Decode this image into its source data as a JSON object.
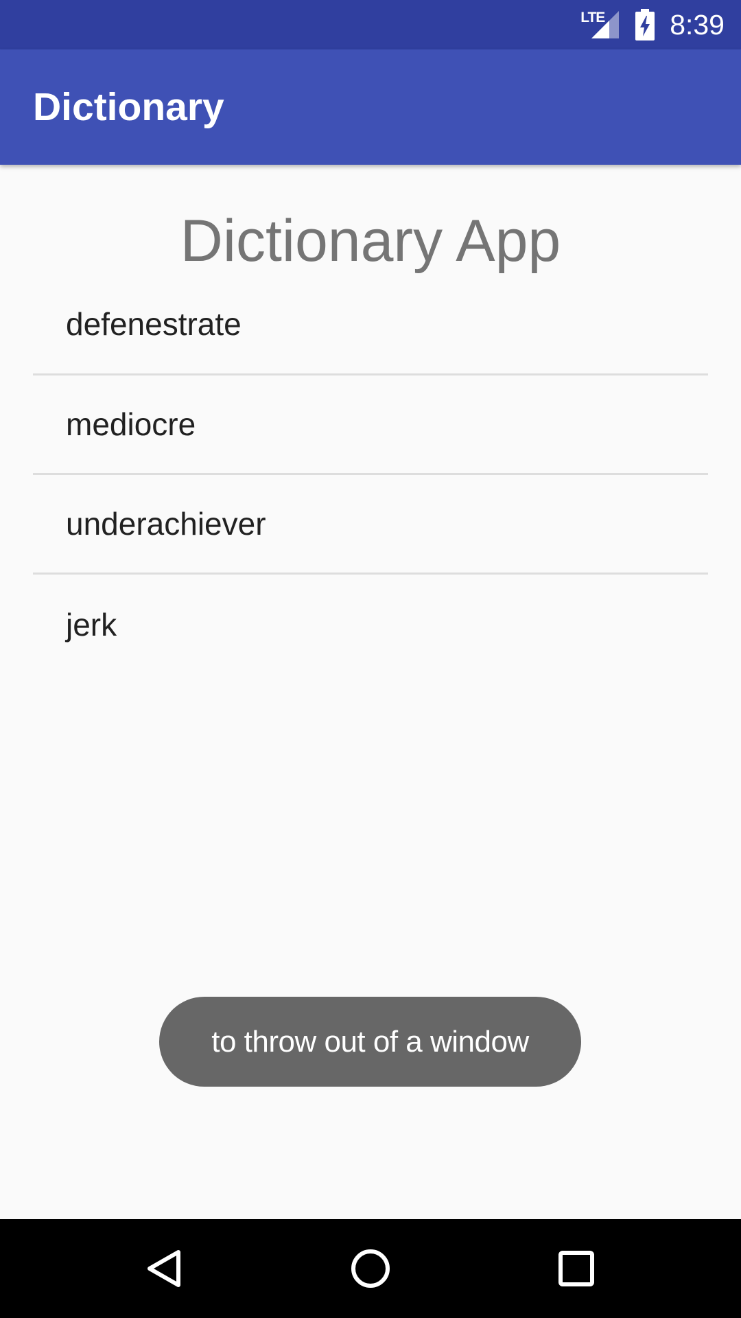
{
  "status_bar": {
    "network": "LTE",
    "time": "8:39",
    "icons": [
      "lte-signal-icon",
      "battery-charging-icon"
    ]
  },
  "app_bar": {
    "title": "Dictionary"
  },
  "main": {
    "heading": "Dictionary App",
    "words": [
      {
        "label": "defenestrate"
      },
      {
        "label": "mediocre"
      },
      {
        "label": "underachiever"
      },
      {
        "label": "jerk"
      }
    ]
  },
  "toast": {
    "message": "to throw out of a window"
  },
  "nav_bar": {
    "icons": [
      "back-icon",
      "home-icon",
      "recents-icon"
    ]
  },
  "colors": {
    "status_bar": "#303F9F",
    "app_bar": "#3F51B5",
    "background": "#FAFAFA",
    "heading_text": "#757575",
    "toast_bg": "#676767",
    "nav_bar": "#000000"
  }
}
